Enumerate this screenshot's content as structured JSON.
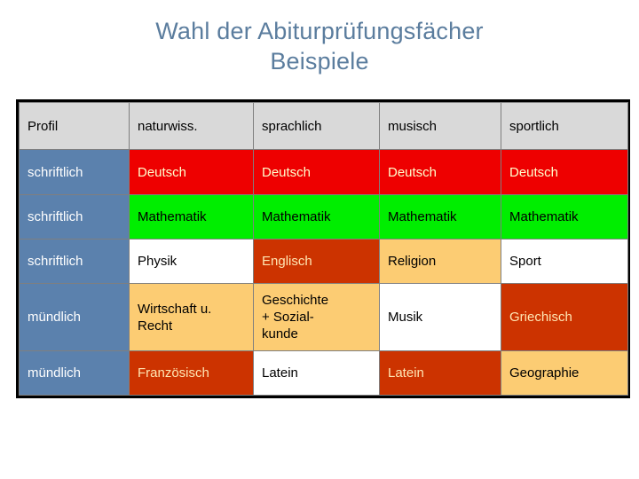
{
  "slide": {
    "title_line1": "Wahl der Abiturprüfungsfächer",
    "title_line2": "Beispiele",
    "title_color": "#5b7d9e",
    "background": "#ffffff"
  },
  "palette": {
    "header_gray": "#d9d9d9",
    "blue": "#5b81ad",
    "red": "#ee0000",
    "green": "#00ee00",
    "white": "#ffffff",
    "dark_red": "#cc3300",
    "light_orange": "#fccc73",
    "border": "#000000"
  },
  "table": {
    "headers": [
      "Profil",
      "naturwiss.",
      "sprachlich",
      "musisch",
      "sportlich"
    ],
    "rows": [
      {
        "label": "schriftlich",
        "cells": [
          "Deutsch",
          "Deutsch",
          "Deutsch",
          "Deutsch"
        ]
      },
      {
        "label": "schriftlich",
        "cells": [
          "Mathematik",
          "Mathematik",
          "Mathematik",
          "Mathematik"
        ]
      },
      {
        "label": "schriftlich",
        "cells": [
          "Physik",
          "Englisch",
          "Religion",
          "Sport"
        ]
      },
      {
        "label": "mündlich",
        "cells": [
          "Wirtschaft u. Recht",
          "Geschichte\n+ Sozial-\nkunde",
          "Musik",
          "Griechisch"
        ]
      },
      {
        "label": "mündlich",
        "cells": [
          "Französisch",
          "Latein",
          "Latein",
          "Geographie"
        ]
      }
    ]
  }
}
